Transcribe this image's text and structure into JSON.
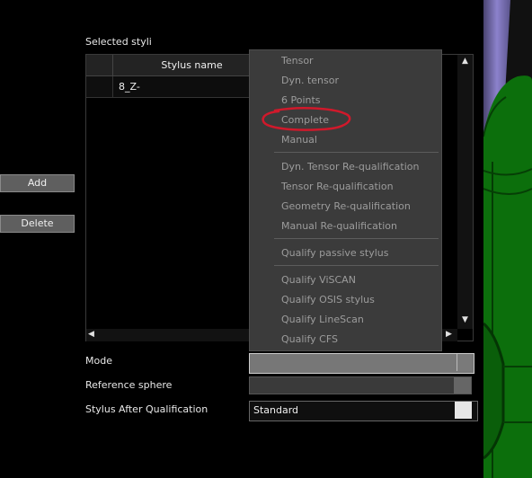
{
  "colors": {
    "panel_bg": "#000000",
    "menu_bg": "#3b3b3b",
    "menu_text": "#9c9c9c",
    "annotation": "#d0192b",
    "model_green": "#0f7a0f",
    "stylus_purple": "#7a70ba"
  },
  "selected_styli_label": "Selected styli",
  "buttons": {
    "add": "Add",
    "delete": "Delete"
  },
  "table": {
    "columns": [
      "Stylus name"
    ],
    "rows": [
      {
        "name": "8_Z-"
      }
    ],
    "scroll": {
      "up": "▲",
      "down": "▼",
      "left": "◀",
      "right": "▶"
    }
  },
  "menu": {
    "items": [
      "Tensor",
      "Dyn. tensor",
      "6 Points",
      "Complete",
      "Manual",
      "Dyn. Tensor Re-qualification",
      "Tensor Re-qualification",
      "Geometry Re-qualification",
      "Manual Re-qualification",
      "Qualify passive stylus",
      "Qualify ViSCAN",
      "Qualify OSIS stylus",
      "Qualify LineScan",
      "Qualify CFS"
    ],
    "highlighted": "Complete"
  },
  "fields": {
    "mode_label": "Mode",
    "reference_sphere_label": "Reference sphere",
    "stylus_after_label": "Stylus After Qualification",
    "stylus_after_value": "Standard"
  }
}
